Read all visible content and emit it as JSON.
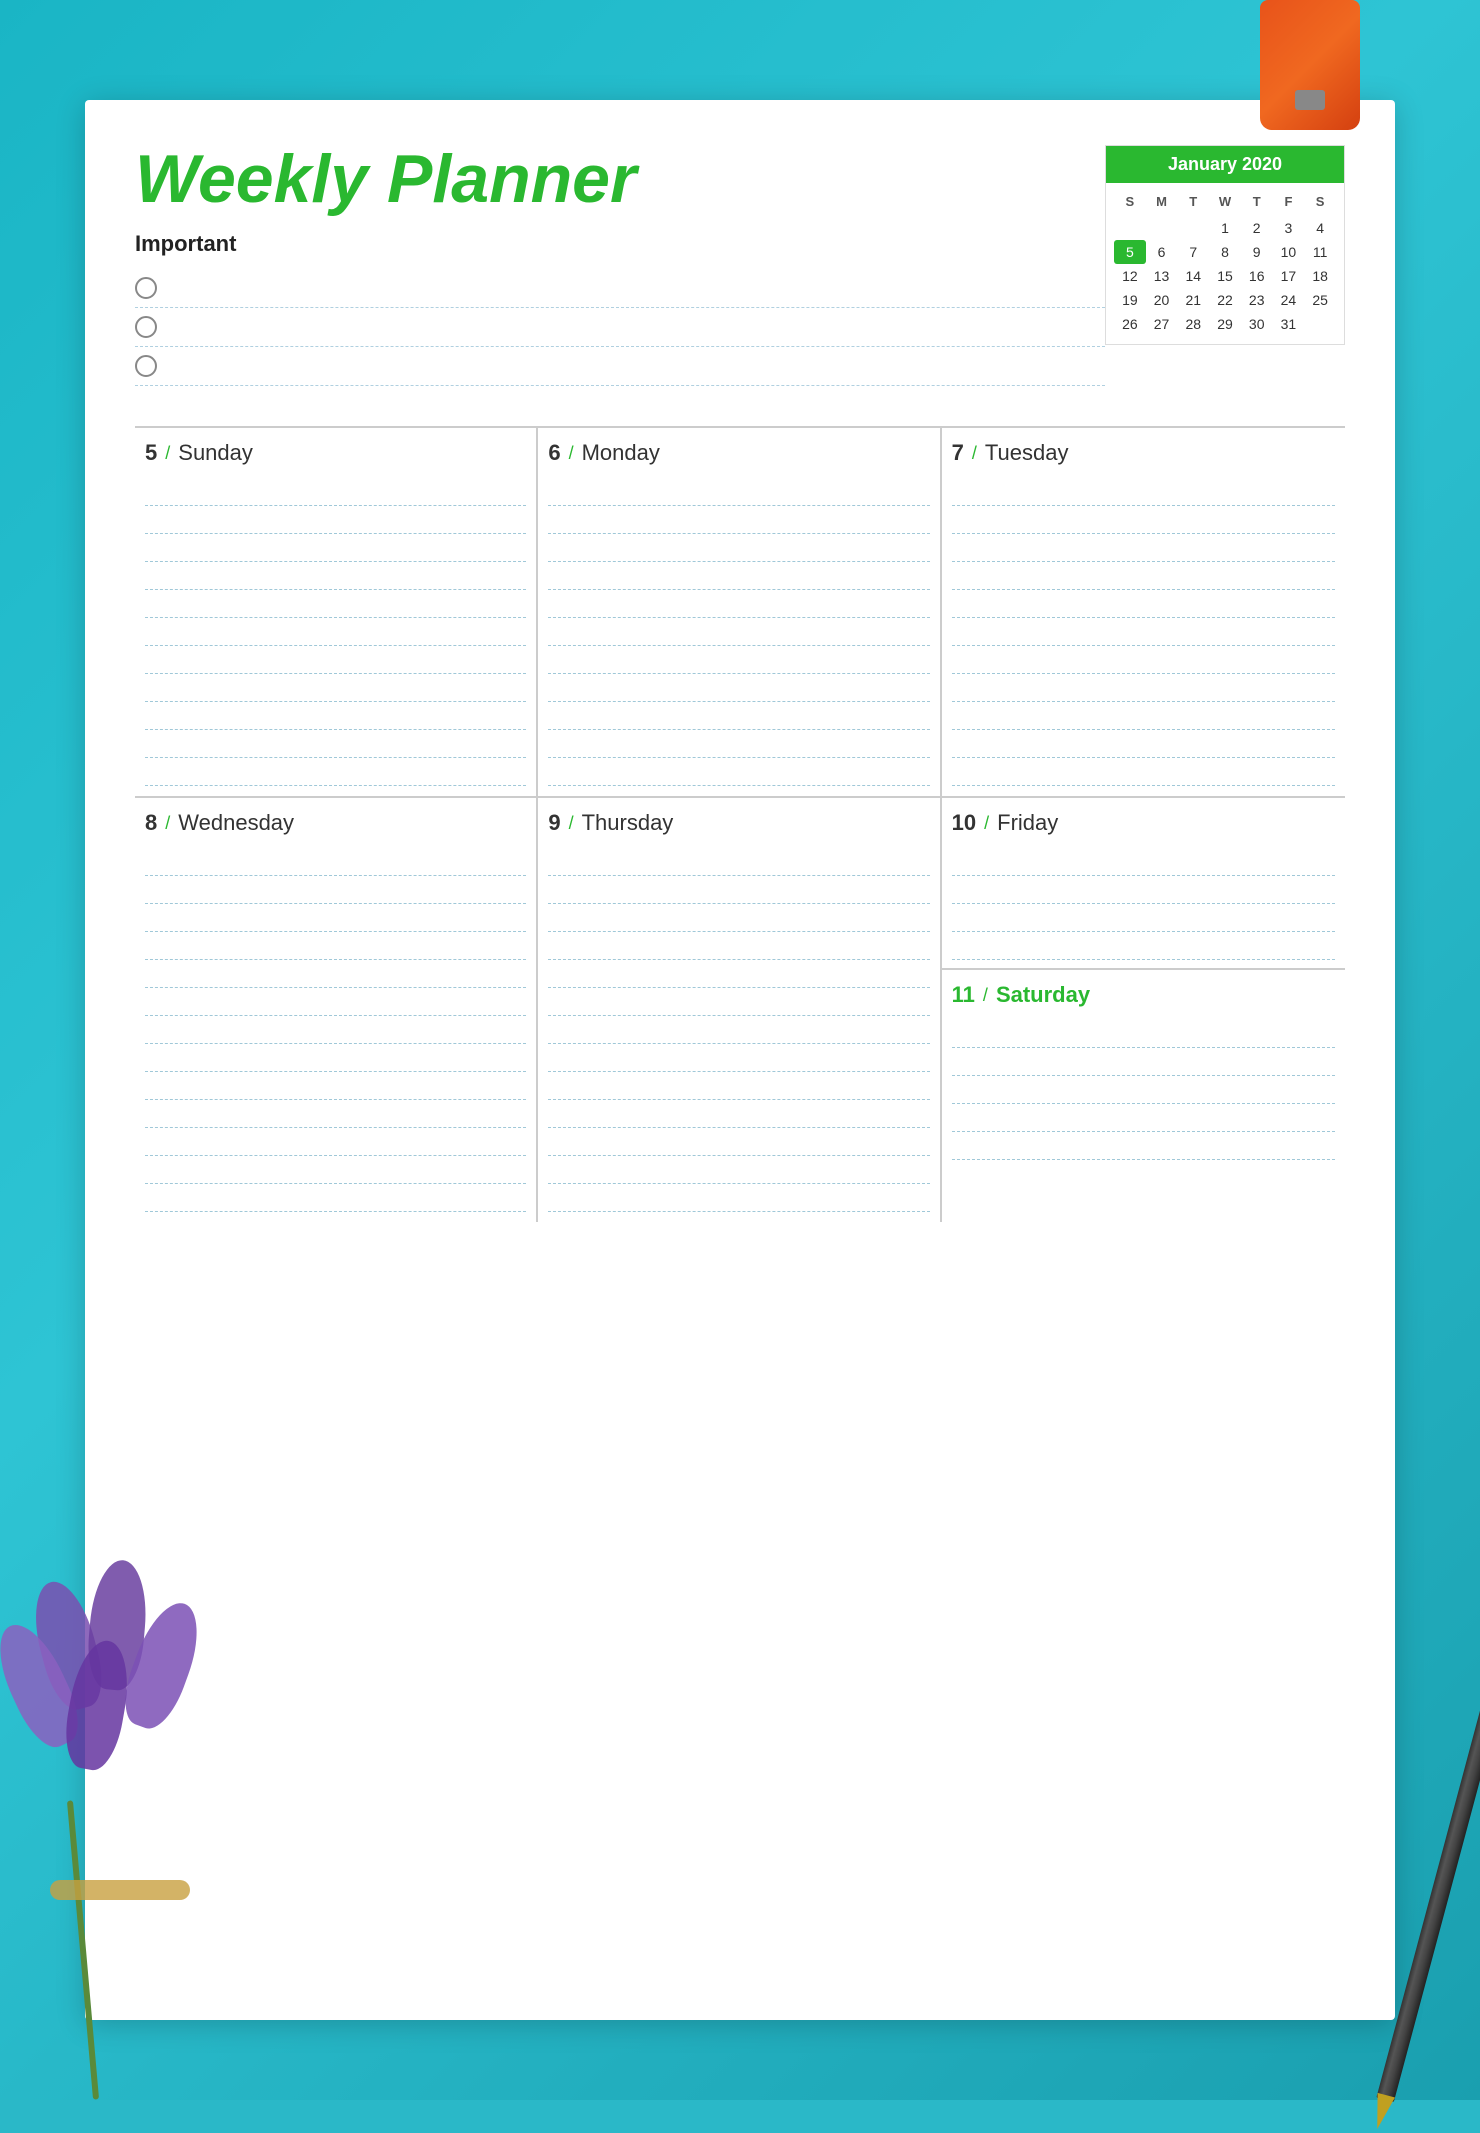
{
  "background": {
    "color": "#2ab8c8"
  },
  "header": {
    "title": "Weekly Planner",
    "important_label": "Important"
  },
  "calendar": {
    "month_year": "January 2020",
    "day_labels": [
      "S",
      "M",
      "T",
      "W",
      "T",
      "F",
      "S"
    ],
    "weeks": [
      [
        "",
        "",
        "",
        "1",
        "2",
        "3",
        "4"
      ],
      [
        "5",
        "6",
        "7",
        "8",
        "9",
        "10",
        "11"
      ],
      [
        "12",
        "13",
        "14",
        "15",
        "16",
        "17",
        "18"
      ],
      [
        "19",
        "20",
        "21",
        "22",
        "23",
        "24",
        "25"
      ],
      [
        "26",
        "27",
        "28",
        "29",
        "30",
        "31",
        ""
      ]
    ],
    "highlight_col": 0
  },
  "checkboxes": [
    {
      "id": 1,
      "checked": false
    },
    {
      "id": 2,
      "checked": false
    },
    {
      "id": 3,
      "checked": false
    }
  ],
  "days_top": [
    {
      "num": "5",
      "slash": "/",
      "name": "Sunday",
      "green": false
    },
    {
      "num": "6",
      "slash": "/",
      "name": "Monday",
      "green": false
    },
    {
      "num": "7",
      "slash": "/",
      "name": "Tuesday",
      "green": false
    }
  ],
  "days_bottom_left": [
    {
      "num": "8",
      "slash": "/",
      "name": "Wednesday",
      "green": false
    },
    {
      "num": "9",
      "slash": "/",
      "name": "Thursday",
      "green": false
    }
  ],
  "days_bottom_right_upper": {
    "num": "10",
    "slash": "/",
    "name": "Friday",
    "green": false
  },
  "days_bottom_right_lower": {
    "num": "11",
    "slash": "/",
    "name": "Saturday",
    "green": true
  },
  "lines_count_top": 11,
  "lines_count_bottom": 13,
  "lines_count_friday": 4,
  "lines_count_saturday": 5
}
